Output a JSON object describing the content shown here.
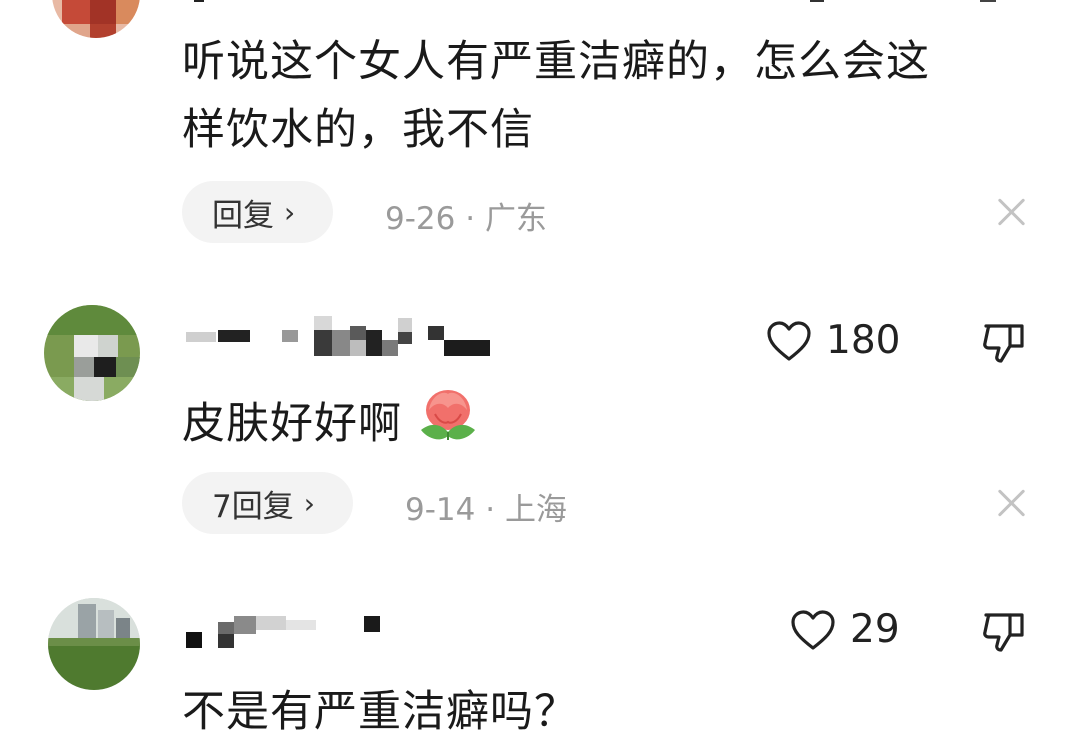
{
  "comments": [
    {
      "text_lines": [
        "听说这个女人有严重洁癖的，怎么会这",
        "样饮水的，我不信"
      ],
      "reply_label": "回复",
      "date": "9-26",
      "location": "广东"
    },
    {
      "likes": "180",
      "text": "皮肤好好啊",
      "reply_label": "7回复",
      "date": "9-14",
      "location": "上海"
    },
    {
      "likes": "29",
      "text": "不是有严重洁癖吗？"
    }
  ],
  "separator": "·",
  "chevron": "›",
  "icons": {
    "like": "heart-icon",
    "dislike": "thumbs-down-icon",
    "dismiss": "close-icon",
    "emoji": "peach-emoji"
  },
  "colors": {
    "text": "#1a1a1a",
    "meta": "#9a9a9a",
    "pill_bg": "#f3f3f3",
    "icon_gray": "#c3c3c3"
  }
}
